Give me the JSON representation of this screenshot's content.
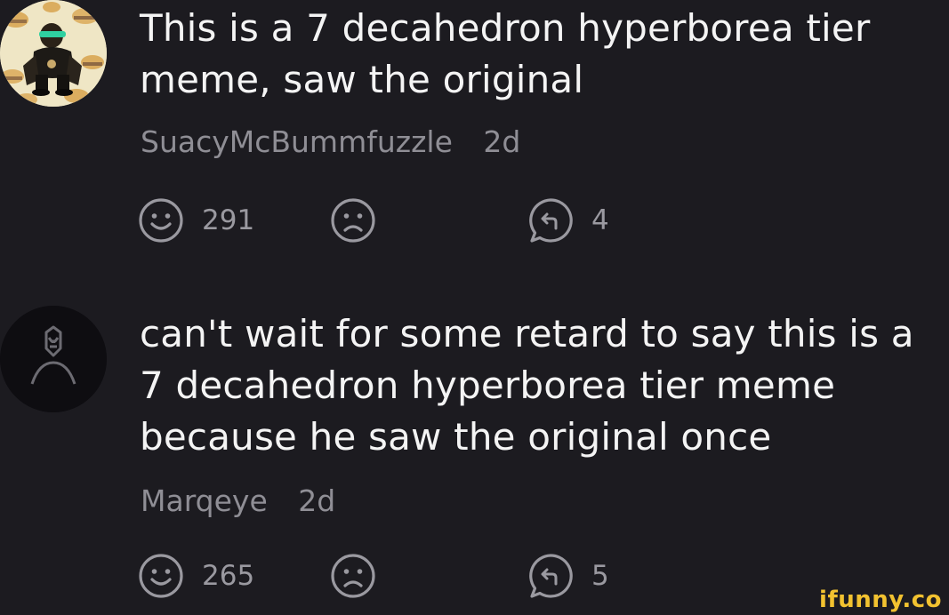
{
  "comments": [
    {
      "avatar": "burger-sticker-avatar",
      "lines": [
        "This is a 7 decahedron hyperborea tier",
        "meme, saw the original"
      ],
      "username": "SuacyMcBummfuzzle",
      "age": "2d",
      "smiles": "291",
      "replies": "4"
    },
    {
      "avatar": "hooded-figure-avatar",
      "lines": [
        "can't wait for some retard to say this is a",
        "7 decahedron hyperborea tier meme",
        "because he saw the original once"
      ],
      "username": "Marqeye",
      "age": "2d",
      "smiles": "265",
      "replies": "5"
    }
  ],
  "icons": {
    "smile": "smile-icon",
    "unsmile": "unsmile-icon",
    "reply": "reply-icon"
  },
  "watermark": "ifunny.co",
  "colors": {
    "background": "#1c1b20",
    "text": "#f4f4f4",
    "meta": "#8f8e95",
    "watermark": "#f2c230"
  }
}
